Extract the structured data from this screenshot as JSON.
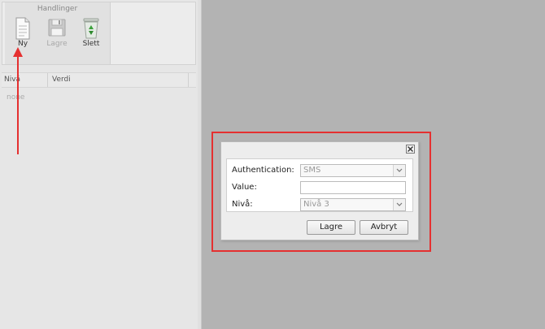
{
  "ribbon": {
    "group_title": "Handlinger",
    "buttons": [
      {
        "label": "Ny",
        "icon": "document-icon"
      },
      {
        "label": "Lagre",
        "icon": "floppy-disk-icon"
      },
      {
        "label": "Slett",
        "icon": "recycle-bin-icon"
      }
    ]
  },
  "grid": {
    "columns": [
      "Nivå",
      "Verdi"
    ],
    "empty_text": "none"
  },
  "dialog": {
    "fields": [
      {
        "label": "Authentication:",
        "value": "SMS",
        "type": "select"
      },
      {
        "label": "Value:",
        "value": "",
        "type": "text"
      },
      {
        "label": "Nivå:",
        "value": "Nivå 3",
        "type": "select"
      }
    ],
    "save_label": "Lagre",
    "cancel_label": "Avbryt"
  },
  "colors": {
    "highlight": "#e53030",
    "arrow": "#e53030"
  }
}
